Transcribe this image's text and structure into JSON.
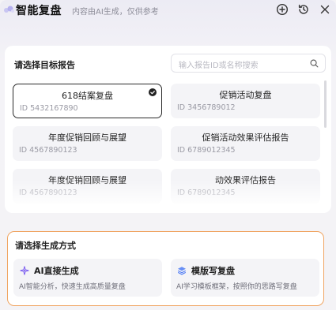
{
  "header": {
    "title": "智能复盘",
    "subtitle": "内容由AI生成，仅供参考",
    "icons": [
      "add-icon",
      "history-icon",
      "close-icon"
    ]
  },
  "target_section": {
    "title": "请选择目标报告",
    "search_placeholder": "输入报告ID或名称搜索",
    "reports": [
      {
        "name": "618结案复盘",
        "id": "ID 5432167890",
        "selected": true
      },
      {
        "name": "促销活动复盘",
        "id": "ID 3456789012",
        "selected": false
      },
      {
        "name": "年度促销回顾与展望",
        "id": "ID 4567890123",
        "selected": false
      },
      {
        "name": "促销活动效果评估报告",
        "id": "ID 6789012345",
        "selected": false
      },
      {
        "name": "年度促销回顾与展望",
        "id": "ID 4567890123",
        "selected": false
      },
      {
        "name": "动效果评估报告",
        "id": "ID 6789012345",
        "selected": false
      }
    ]
  },
  "method_section": {
    "title": "请选择生成方式",
    "methods": [
      {
        "label": "AI直接生成",
        "desc": "AI智能分析，快速生成高质量复盘",
        "icon": "sparkle-icon"
      },
      {
        "label": "模版写复盘",
        "desc": "AI学习模板框架，按照你的思路写复盘",
        "icon": "layers-icon"
      }
    ]
  },
  "colors": {
    "accent_orange": "#f0a562",
    "icon_purple": "#7b5cf0",
    "icon_blue": "#4f7cf5"
  }
}
